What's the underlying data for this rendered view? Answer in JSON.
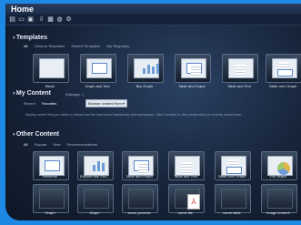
{
  "window": {
    "title": "Home"
  },
  "toolbar": {
    "icons": [
      "new-icon",
      "open-icon",
      "save-icon",
      "import-icon",
      "delete-icon",
      "link-icon",
      "settings-icon"
    ]
  },
  "templates": {
    "heading": "Templates",
    "tabs": [
      "All",
      "General Templates",
      "Shared Templates",
      "My Templates"
    ],
    "items": [
      "Blank",
      "Graph and Text",
      "Bar Graph",
      "Table and Graph",
      "Table and Text",
      "Table over Graph"
    ]
  },
  "my_content": {
    "heading": "My Content",
    "count": "(Manage...)",
    "tabs": [
      "Recent",
      "Favorites"
    ],
    "browse_label": "Browse content from",
    "hint": "Display content that you edited or viewed and the most recent dashboards and workspaces. Click Favorites to view content that you recently viewed here."
  },
  "other_content": {
    "heading": "Other Content",
    "tabs": [
      "All",
      "Popular",
      "New",
      "Recommendations"
    ],
    "row1": [
      "Revenue",
      "Explore Bar Gra...",
      "Table and Graph",
      "Table and Text",
      "Table over Graph",
      "Pie Graph"
    ],
    "row2": [
      "Graph",
      "Graph",
      "some process",
      "some file",
      "some table",
      "image content"
    ]
  }
}
